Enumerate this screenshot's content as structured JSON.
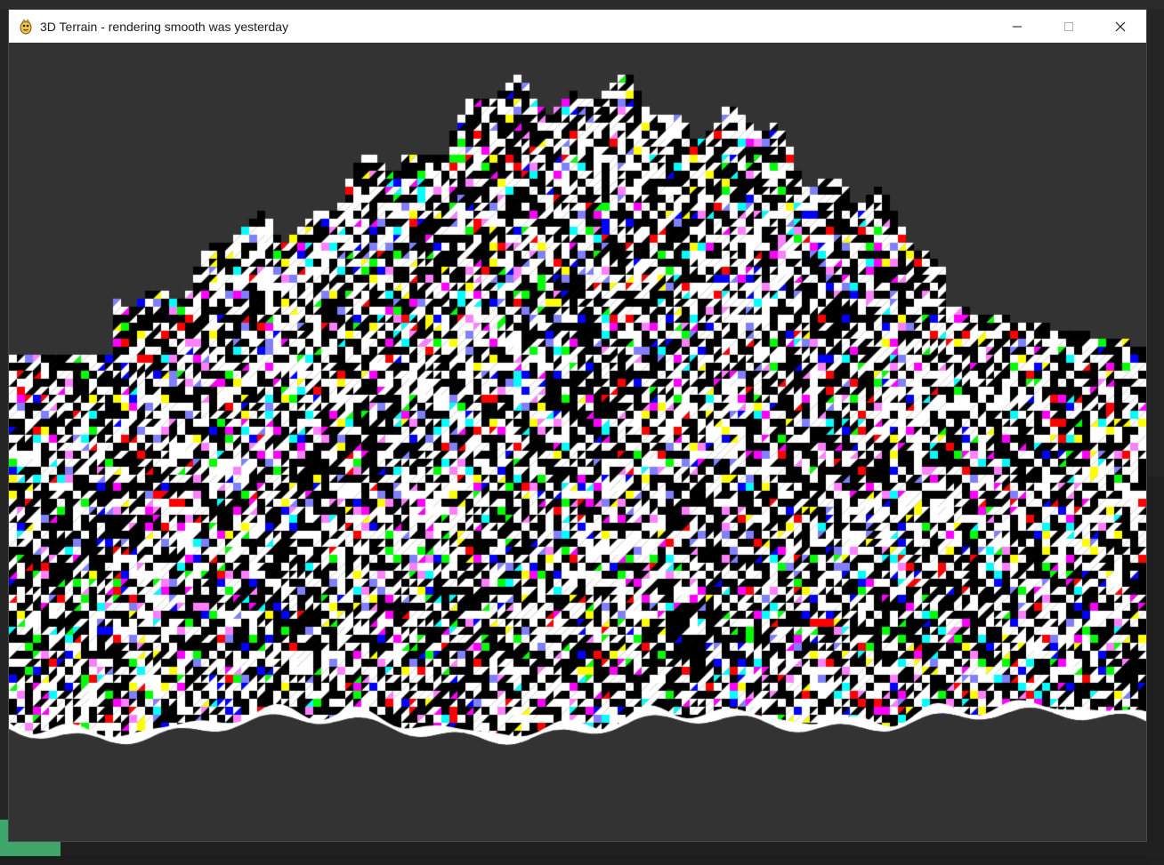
{
  "window": {
    "title": "3D Terrain - rendering smooth was yesterday",
    "icon": "pygame-snake-icon",
    "controls": [
      {
        "name": "minimize",
        "icon": "minimize-icon"
      },
      {
        "name": "maximize",
        "icon": "maximize-icon"
      },
      {
        "name": "close",
        "icon": "close-icon"
      }
    ]
  },
  "viewport": {
    "background_color": "#333333",
    "scene": "terrain-mesh",
    "palette": [
      "#ffffff",
      "#000000",
      "#00ffff",
      "#ff00ff",
      "#ffff00",
      "#0000ff",
      "#00ff00",
      "#ff0000",
      "#8080ff",
      "#ff80ff"
    ]
  },
  "desktop": {
    "accent_color": "#3fa66b"
  }
}
